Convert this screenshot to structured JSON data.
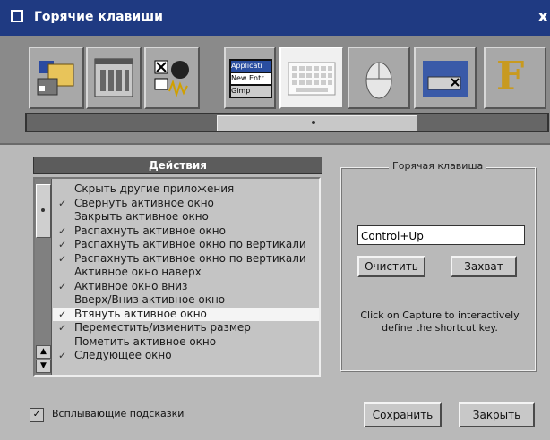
{
  "window": {
    "title": "Горячие клавиши",
    "close": "x"
  },
  "panels": {
    "tiles": [
      {
        "name": "folder-panel",
        "label": ""
      },
      {
        "name": "window-panel",
        "label": ""
      },
      {
        "name": "media-panel",
        "label": ""
      },
      {
        "name": "taskbar-panel",
        "label": "Applicati|New Entr|Gimp"
      },
      {
        "name": "keyboard-panel",
        "label": ""
      },
      {
        "name": "mouse-panel",
        "label": ""
      },
      {
        "name": "window-placement-panel",
        "label": ""
      },
      {
        "name": "font-panel",
        "label": "F"
      }
    ],
    "tile_texts": [
      "Applicati",
      "New Entr",
      "Gimp"
    ],
    "font_letter": "F"
  },
  "actions": {
    "header": "Действия",
    "items": [
      {
        "label": "Скрыть другие приложения",
        "checked": false
      },
      {
        "label": "Свернуть активное окно",
        "checked": true
      },
      {
        "label": "Закрыть активное окно",
        "checked": false
      },
      {
        "label": "Распахнуть активное окно",
        "checked": true
      },
      {
        "label": "Распахнуть активное окно по вертикали",
        "checked": true
      },
      {
        "label": "Распахнуть активное окно по вертикали",
        "checked": true
      },
      {
        "label": "Активное окно наверх",
        "checked": false
      },
      {
        "label": "Активное окно вниз",
        "checked": true
      },
      {
        "label": "Вверх/Вниз активное окно",
        "checked": false
      },
      {
        "label": "Втянуть активное окно",
        "checked": true,
        "selected": true
      },
      {
        "label": "Переместить/изменить размер",
        "checked": true
      },
      {
        "label": "Пометить активное окно",
        "checked": false
      },
      {
        "label": "Следующее окно",
        "checked": true
      }
    ]
  },
  "hotkey": {
    "group_title": "Горячая клавиша",
    "value": "Control+Up",
    "clear_label": "Очистить",
    "capture_label": "Захват",
    "hint": "Click on Capture to interactively define the shortcut key."
  },
  "footer": {
    "tooltips_label": "Всплывающие подсказки",
    "tooltips_checked": true,
    "save_label": "Сохранить",
    "close_label": "Закрыть"
  },
  "colors": {
    "titlebar": "#1f3a82",
    "selected_row": "#f4f4f4",
    "background": "#b9b9b9"
  }
}
